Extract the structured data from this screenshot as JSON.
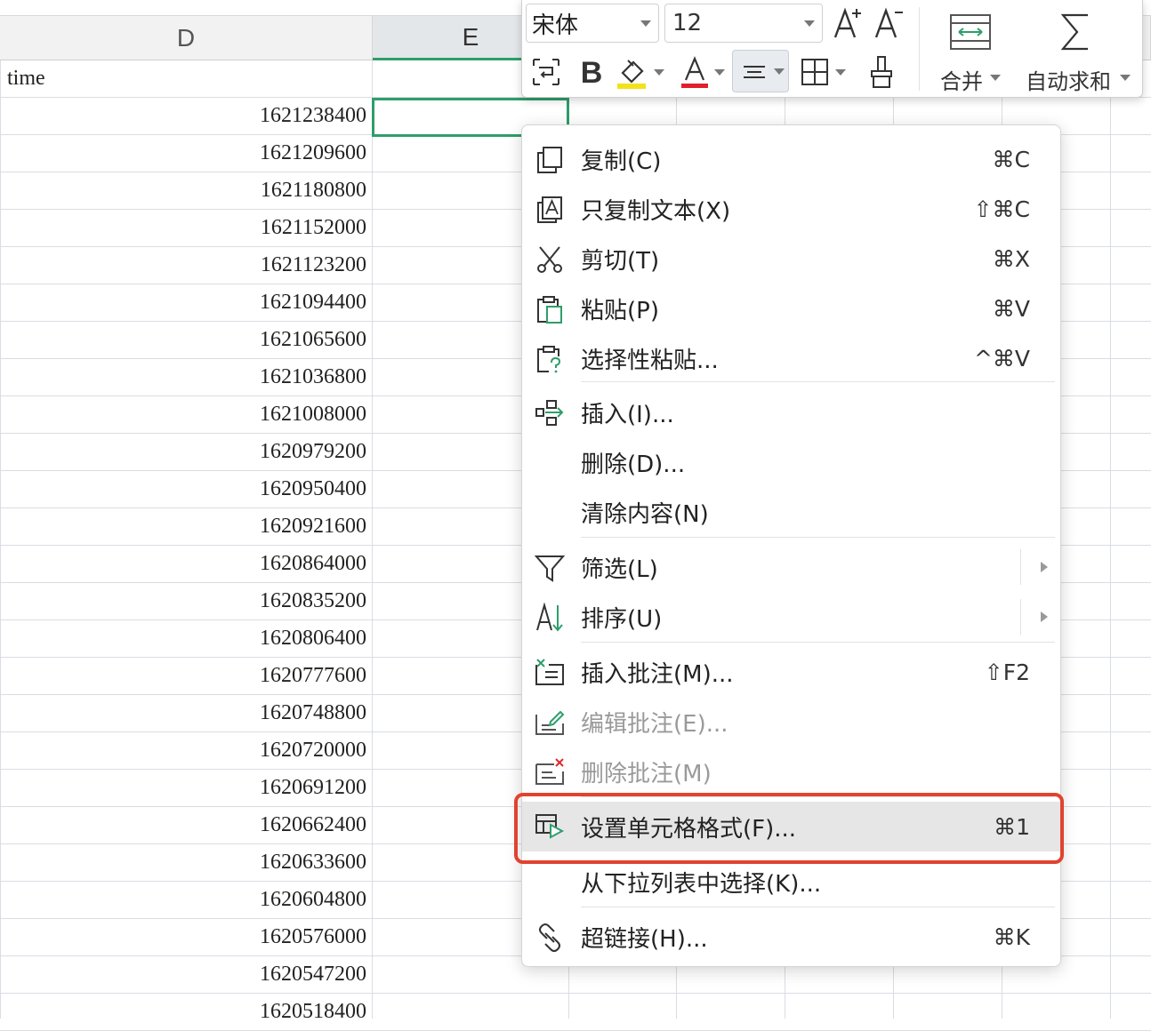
{
  "sheet": {
    "columns": [
      {
        "letter": "D",
        "selected": false
      },
      {
        "letter": "E",
        "selected": true
      }
    ],
    "header_cell": "time",
    "values": [
      "1621238400",
      "1621209600",
      "1621180800",
      "1621152000",
      "1621123200",
      "1621094400",
      "1621065600",
      "1621036800",
      "1621008000",
      "1620979200",
      "1620950400",
      "1620921600",
      "1620864000",
      "1620835200",
      "1620806400",
      "1620777600",
      "1620748800",
      "1620720000",
      "1620691200",
      "1620662400",
      "1620633600",
      "1620604800",
      "1620576000",
      "1620547200",
      "1620518400"
    ],
    "selection_color": "#2e9e6a"
  },
  "toolbar": {
    "font_name": "宋体",
    "font_size": "12",
    "merge_label": "合并",
    "autosum_label": "自动求和",
    "highlight_color": "#f2e21a",
    "font_color": "#e0202a",
    "icon_color": "#2e9e6a"
  },
  "menu": {
    "items": [
      {
        "label": "复制(C)",
        "shortcut": "⌘C",
        "icon": "copy-icon"
      },
      {
        "label": "只复制文本(X)",
        "shortcut": "⇧⌘C",
        "icon": "copy-text-icon"
      },
      {
        "label": "剪切(T)",
        "shortcut": "⌘X",
        "icon": "scissors-icon"
      },
      {
        "label": "粘贴(P)",
        "shortcut": "⌘V",
        "icon": "paste-icon"
      },
      {
        "label": "选择性粘贴...",
        "shortcut": "^⌘V",
        "icon": "paste-special-icon"
      },
      {
        "label": "插入(I)...",
        "shortcut": "",
        "icon": "insert-icon"
      },
      {
        "label": "删除(D)...",
        "shortcut": ""
      },
      {
        "label": "清除内容(N)",
        "shortcut": ""
      },
      {
        "label": "筛选(L)",
        "shortcut": "",
        "icon": "filter-icon",
        "submenu": true
      },
      {
        "label": "排序(U)",
        "shortcut": "",
        "icon": "sort-icon",
        "submenu": true
      },
      {
        "label": "插入批注(M)...",
        "shortcut": "⇧F2",
        "icon": "insert-comment-icon"
      },
      {
        "label": "编辑批注(E)...",
        "shortcut": "",
        "icon": "edit-comment-icon",
        "disabled": true
      },
      {
        "label": "删除批注(M)",
        "shortcut": "",
        "icon": "delete-comment-icon",
        "disabled": true
      },
      {
        "label": "设置单元格格式(F)...",
        "shortcut": "⌘1",
        "icon": "format-cells-icon",
        "highlighted": true
      },
      {
        "label": "从下拉列表中选择(K)...",
        "shortcut": ""
      },
      {
        "label": "超链接(H)...",
        "shortcut": "⌘K",
        "icon": "hyperlink-icon"
      }
    ],
    "highlight_outline_color": "#e0432f"
  }
}
